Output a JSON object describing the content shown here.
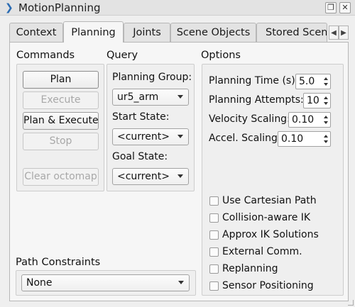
{
  "window": {
    "title": "MotionPlanning",
    "app_icon": "rviz-chevron-icon"
  },
  "tabs": [
    {
      "label": "Context"
    },
    {
      "label": "Planning",
      "active": true
    },
    {
      "label": "Joints"
    },
    {
      "label": "Scene Objects"
    },
    {
      "label": "Stored Scenes"
    }
  ],
  "tab_scroll": {
    "left": "◀",
    "right": "▶"
  },
  "commands": {
    "heading": "Commands",
    "plan": "Plan",
    "execute": "Execute",
    "plan_execute": "Plan & Execute",
    "stop": "Stop",
    "clear_octomap": "Clear octomap"
  },
  "query": {
    "heading": "Query",
    "planning_group_label": "Planning Group:",
    "planning_group_value": "ur5_arm",
    "start_state_label": "Start State:",
    "start_state_value": "<current>",
    "goal_state_label": "Goal State:",
    "goal_state_value": "<current>"
  },
  "options": {
    "heading": "Options",
    "planning_time_label": "Planning Time (s):",
    "planning_time_value": "5.0",
    "planning_attempts_label": "Planning Attempts:",
    "planning_attempts_value": "10",
    "velocity_scaling_label": "Velocity Scaling:",
    "velocity_scaling_value": "0.10",
    "accel_scaling_label": "Accel. Scaling:",
    "accel_scaling_value": "0.10",
    "checkboxes": [
      {
        "label": "Use Cartesian Path",
        "checked": false
      },
      {
        "label": "Collision-aware IK",
        "checked": false
      },
      {
        "label": "Approx IK Solutions",
        "checked": false
      },
      {
        "label": "External Comm.",
        "checked": false
      },
      {
        "label": "Replanning",
        "checked": false
      },
      {
        "label": "Sensor Positioning",
        "checked": false
      }
    ]
  },
  "path_constraints": {
    "heading": "Path Constraints",
    "value": "None"
  }
}
